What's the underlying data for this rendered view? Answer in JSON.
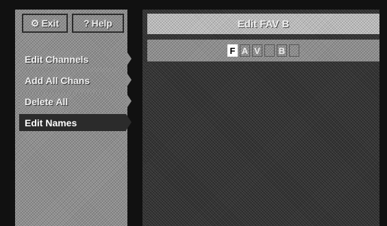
{
  "toolbar": {
    "exit_label": "Exit",
    "help_label": "Help",
    "exit_icon": "remote-icon",
    "help_icon": "question-icon"
  },
  "menu": {
    "items": [
      {
        "label": "Edit Channels",
        "active": false
      },
      {
        "label": "Add All Chans",
        "active": false
      },
      {
        "label": "Delete All",
        "active": false
      },
      {
        "label": "Edit Names",
        "active": true
      }
    ]
  },
  "editor": {
    "title": "Edit FAV B",
    "name_chars": [
      "F",
      "A",
      "V",
      "",
      "B",
      ""
    ],
    "cursor_index": 0
  },
  "colors": {
    "active_char_bg": "#ffffff",
    "active_menu_bg": "#2b2b2b",
    "screen_bg": "#111111"
  }
}
